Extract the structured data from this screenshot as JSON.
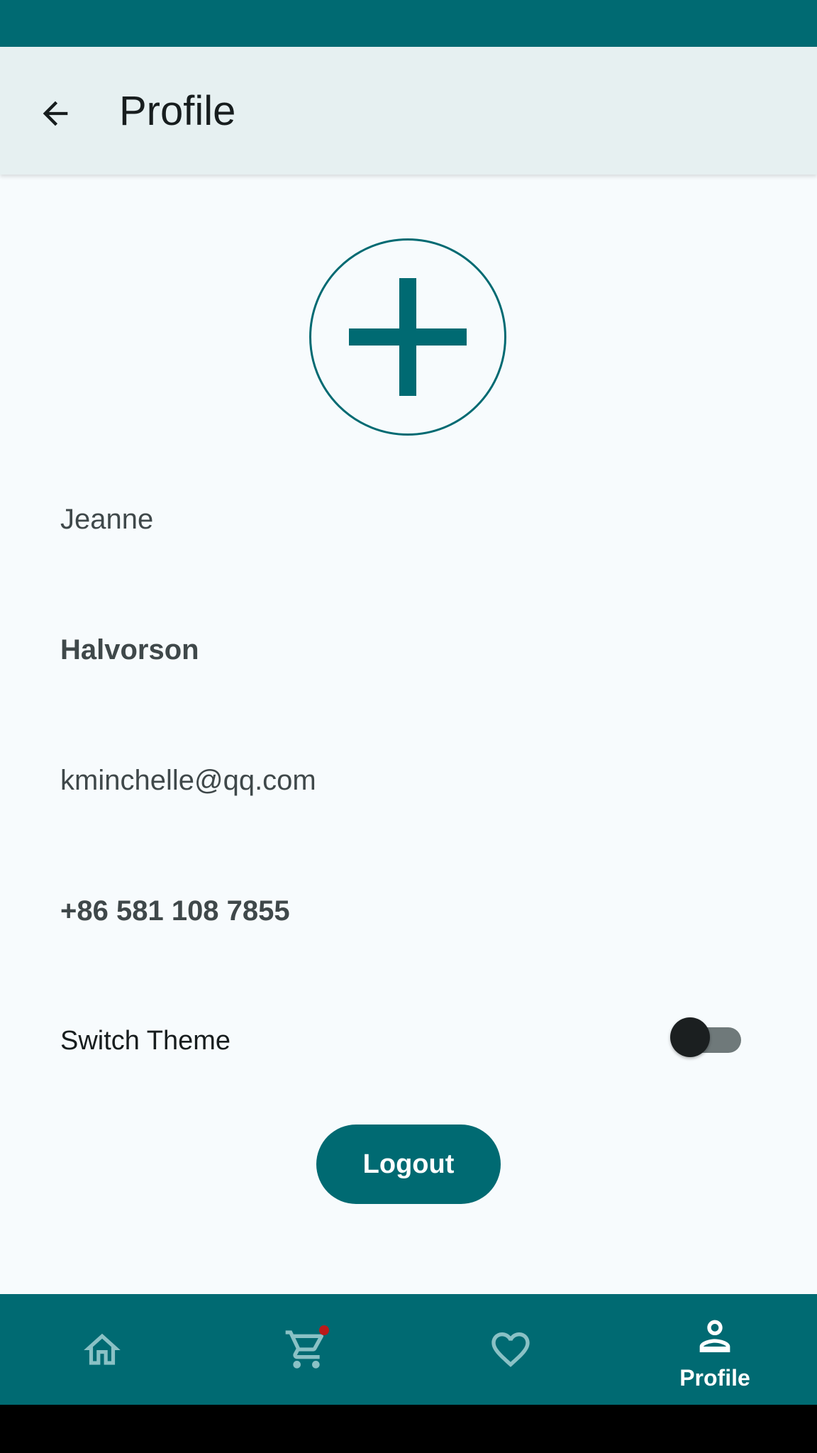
{
  "app_bar": {
    "title": "Profile",
    "back_icon": "arrow-back-icon"
  },
  "avatar": {
    "icon": "add-icon"
  },
  "profile": {
    "first_name": "Jeanne",
    "last_name": "Halvorson",
    "email": "kminchelle@qq.com",
    "phone": "+86 581 108 7855"
  },
  "settings": {
    "theme_label": "Switch Theme",
    "theme_switch_on": false
  },
  "actions": {
    "logout_label": "Logout"
  },
  "bottom_nav": {
    "items": [
      {
        "icon": "home-icon",
        "label": "",
        "selected": false
      },
      {
        "icon": "cart-icon",
        "label": "",
        "selected": false,
        "badge": true
      },
      {
        "icon": "heart-icon",
        "label": "",
        "selected": false
      },
      {
        "icon": "person-icon",
        "label": "Profile",
        "selected": true
      }
    ]
  },
  "colors": {
    "primary": "#006a72",
    "app_bar_bg": "#e6f0f1",
    "background": "#f7fbfd",
    "badge": "#ba1a1a"
  }
}
